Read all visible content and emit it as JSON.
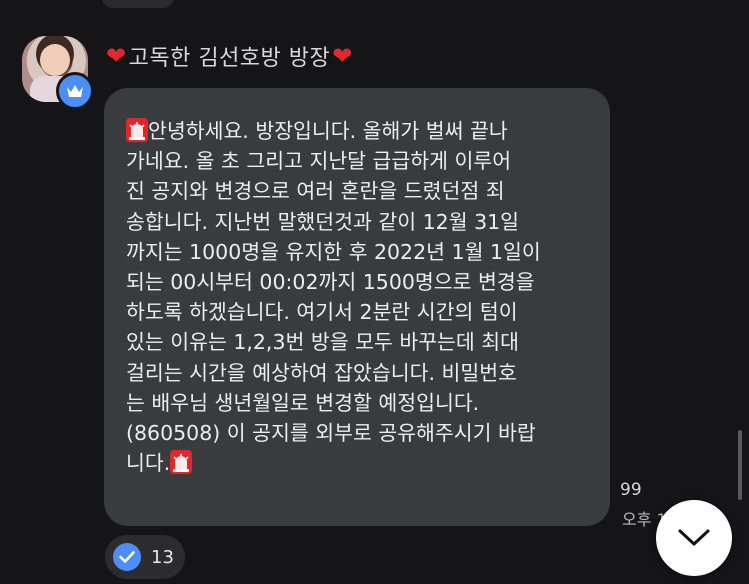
{
  "sender": {
    "name": "고독한 김선호방 방장",
    "badge_icon": "crown-icon",
    "decoration_icon": "red-heart-icon"
  },
  "message": {
    "line_1": "안녕하세요. 방장입니다. 올해가 벌써 끝나",
    "body": "가네요. 올 초 그리고 지난달 급급하게 이루어\n진 공지와 변경으로 여러 혼란을 드렸던점 죄\n송합니다. 지난번 말했던것과 같이 12월 31일\n까지는 1000명을 유지한 후 2022년 1월 1일이\n되는 00시부터 00:02까지 1500명으로 변경을\n하도록 하겠습니다. 여기서 2분란 시간의 텀이\n있는 이유는 1,2,3번 방을 모두 바꾸는데 최대\n걸리는 시간을 예상하여 잡았습니다. 비밀번호\n는 배우님 생년월일로 변경할 예정입니다.\n(860508) 이 공지를 외부로 공유해주시기 바랍",
    "last_line": "니다.",
    "emoji_icon": "siren-icon"
  },
  "meta": {
    "unread_count": "99",
    "time": "오후 1"
  },
  "reaction": {
    "icon": "check-icon",
    "count": "13"
  },
  "controls": {
    "scroll_down_icon": "chevron-down-icon"
  },
  "colors": {
    "background": "#151518",
    "bubble": "#3a3b3f",
    "accent": "#4c8df6",
    "heart": "#e0282e",
    "siren": "#e2262a"
  }
}
